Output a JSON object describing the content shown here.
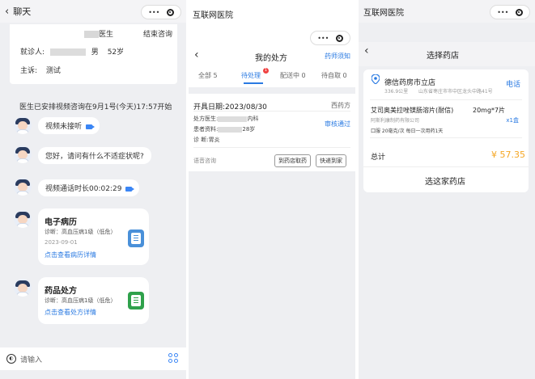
{
  "chat": {
    "title": "聊天",
    "doctor_suffix": "医生",
    "end_consult": "结束咨询",
    "patient_label": "就诊人:",
    "patient_gender": "男",
    "patient_age": "52岁",
    "complaint_label": "主诉:",
    "complaint": "测试",
    "schedule_notice": "医生已安排视频咨询在9月1号(今天)17:57开始",
    "messages": [
      {
        "text": "视频未接听"
      },
      {
        "text": "您好，请问有什么不适症状呢?"
      },
      {
        "text": "视频通话时长00:02:29"
      }
    ],
    "record": {
      "title": "电子病历",
      "diagnosis": "诊断：高血压病1级（低危）",
      "date": "2023-09-01",
      "link": "点击查看病历详情"
    },
    "prescription": {
      "title": "药品处方",
      "diagnosis": "诊断：高血压病1级（低危）",
      "link": "点击查看处方详情"
    },
    "input_placeholder": "请输入"
  },
  "rx": {
    "app_title": "互联网医院",
    "title": "我的处方",
    "notice": "药师须知",
    "tabs": [
      {
        "label": "全部 5"
      },
      {
        "label": "待处理"
      },
      {
        "label": "配送中 0"
      },
      {
        "label": "待自取 0"
      }
    ],
    "pending_badge": "1",
    "date_label": "开具日期:2023/08/30",
    "type": "西药方",
    "doctor_label": "处方医生:",
    "dept": "内科",
    "patient_label": "患者资料:",
    "patient_age": "28岁",
    "diagnosis": "诊 断:胃炎",
    "status": "审核通过",
    "consult_type": "语音咨询",
    "pickup_button": "到药店取药",
    "delivery_button": "快递到家"
  },
  "pharmacy": {
    "app_title": "互联网医院",
    "title": "选择药店",
    "name": "德信药房市立店",
    "call": "电话",
    "distance": "336.9公里",
    "address": "山东省枣庄市市中区龙头中路41号",
    "drug_name": "艾司奥美拉唑镁肠溶片(耐信)",
    "drug_spec": "20mg*7片",
    "maker": "阿斯利康制药有限公司",
    "qty": "x1盒",
    "usage": "口服 20毫克/次 每日一次用药1天",
    "total_label": "总计",
    "total": "¥ 57.35",
    "select_button": "选这家药店"
  },
  "colors": {
    "accent": "#2a7ae2",
    "price": "#f5a623",
    "badge": "#f04141"
  }
}
